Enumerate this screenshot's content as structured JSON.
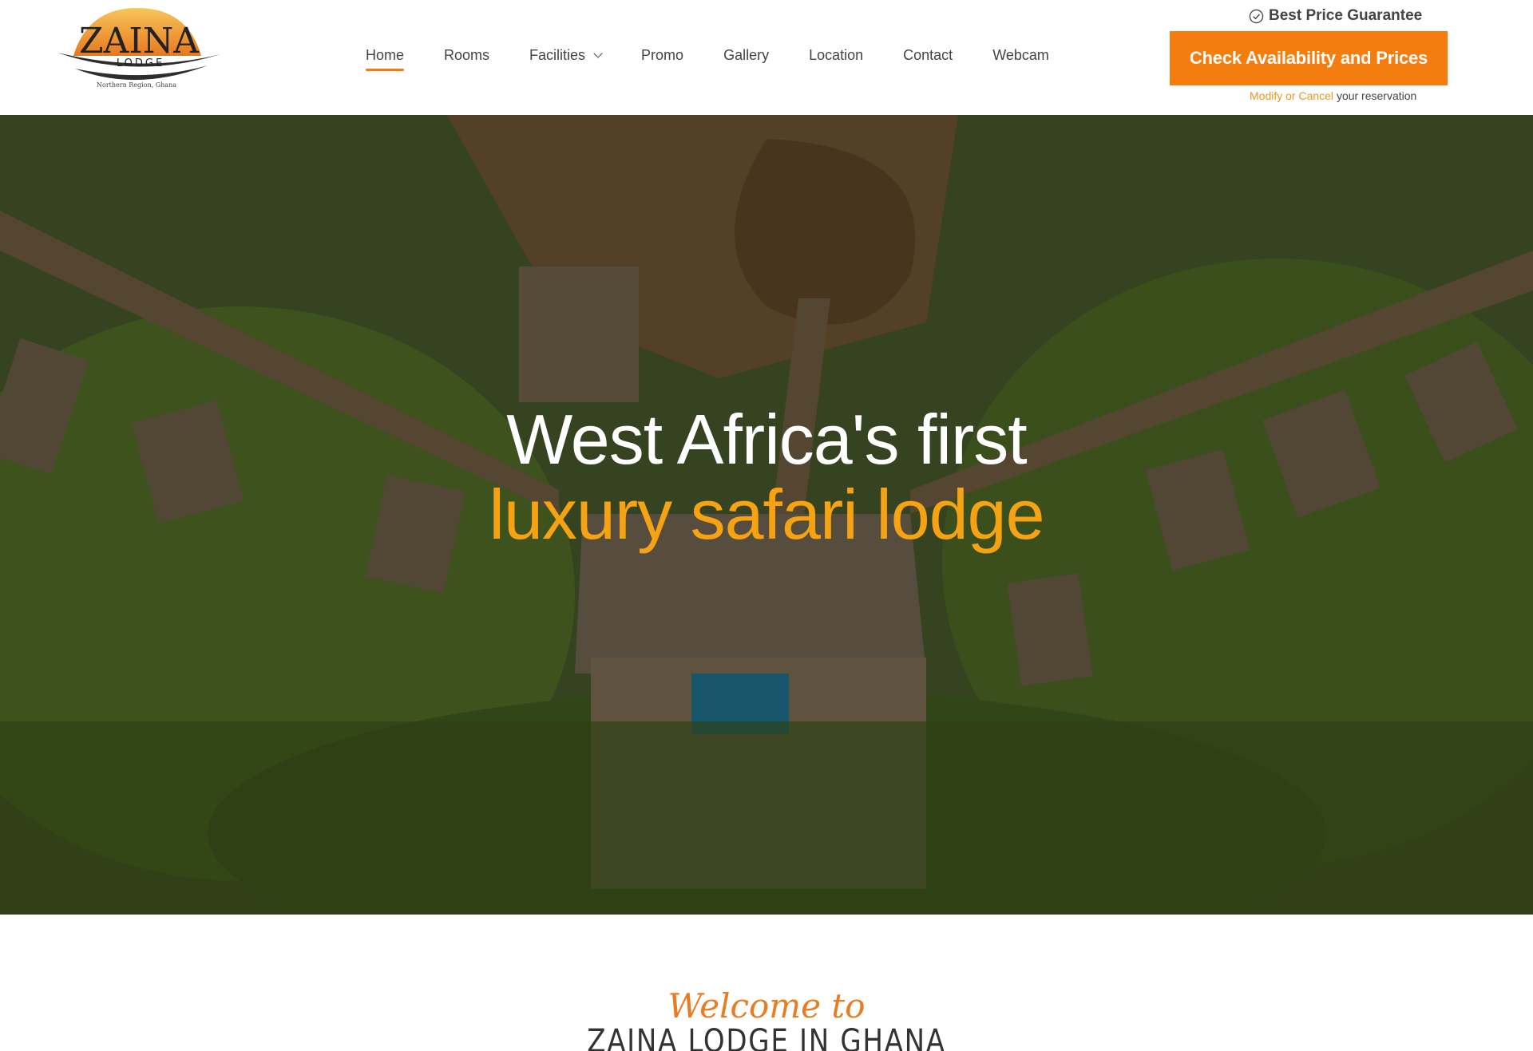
{
  "logo": {
    "name": "ZAINA",
    "sub": "LODGE",
    "tagline": "Northern Region, Ghana"
  },
  "nav": {
    "items": [
      {
        "label": "Home",
        "active": true
      },
      {
        "label": "Rooms"
      },
      {
        "label": "Facilities",
        "icon": "chevron-down-icon"
      },
      {
        "label": "Promo"
      },
      {
        "label": "Gallery"
      },
      {
        "label": "Location"
      },
      {
        "label": "Contact"
      },
      {
        "label": "Webcam"
      }
    ]
  },
  "booking": {
    "guarantee": "Best Price Guarantee",
    "guarantee_icon": "check-circle-icon",
    "cta_label": "Check Availability and Prices",
    "modify_link": "Modify or Cancel",
    "modify_text": "your reservation"
  },
  "hero": {
    "line1": "West Africa's first",
    "line2": "luxury safari lodge"
  },
  "welcome": {
    "script": "Welcome to",
    "title": "ZAINA LODGE IN GHANA"
  },
  "colors": {
    "accent": "#f57d0f",
    "highlight": "#f5a213",
    "text": "#444444"
  }
}
